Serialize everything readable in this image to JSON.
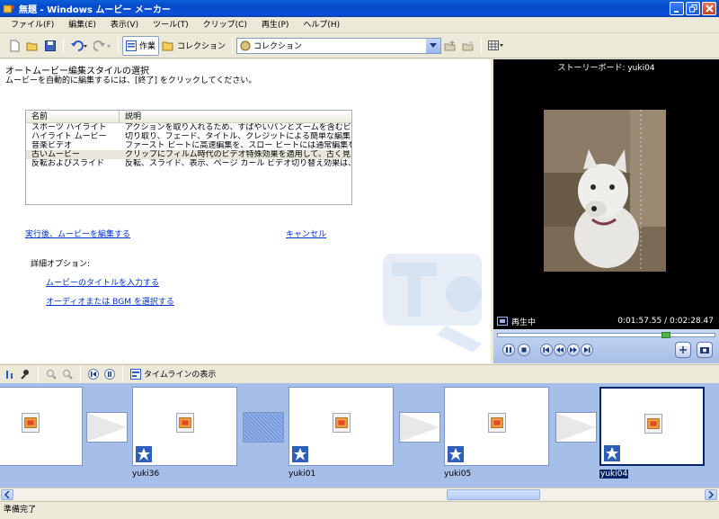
{
  "window": {
    "title": "無題 - Windows ムービー メーカー"
  },
  "menu": {
    "items": [
      "ファイル(F)",
      "編集(E)",
      "表示(V)",
      "ツール(T)",
      "クリップ(C)",
      "再生(P)",
      "ヘルプ(H)"
    ]
  },
  "toolbar": {
    "tasks_label": "作業",
    "collections_label": "コレクション",
    "collection_combo_value": "コレクション"
  },
  "task_pane": {
    "title": "オートムービー編集スタイルの選択",
    "subtitle": "ムービーを自動的に編集するには、[終了] をクリックしてください。",
    "columns": [
      "名前",
      "説明"
    ],
    "styles": [
      {
        "name": "スポーツ ハイライト",
        "desc": "アクションを取り入れるため、すばやいパンとズームを含むビデオクリッ..."
      },
      {
        "name": "ハイライト ムービー",
        "desc": "切り取り、フェード、タイトル、クレジットによる簡単な編集"
      },
      {
        "name": "音楽ビデオ",
        "desc": "ファースト ビートに高速編集を、スロー ビートには通常編集を使用..."
      },
      {
        "name": "古いムービー",
        "desc": "クリップにフィルム時代のビデオ特殊効果を適用して、古く見えるムー..."
      },
      {
        "name": "反転およびスライド",
        "desc": "反転、スライド、表示、ページ カール ビデオ切り替え効果は、クリッ..."
      }
    ],
    "run_link": "実行後、ムービーを編集する",
    "cancel_link": "キャンセル",
    "options_label": "詳細オプション:",
    "title_link": "ムービーのタイトルを入力する",
    "audio_link": "オーディオまたは BGM を選択する"
  },
  "preview": {
    "title": "ストーリーボード: yuki04",
    "state": "再生中",
    "time": "0:01:57.55 / 0:02:28.47",
    "seek_fraction": 0.79
  },
  "storyboard_toolbar": {
    "timeline_label": "タイムラインの表示"
  },
  "storyboard": {
    "clips": [
      {
        "name": ""
      },
      {
        "name": "yuki36"
      },
      {
        "name": "yuki01"
      },
      {
        "name": "yuki05"
      },
      {
        "name": "yuki04"
      }
    ]
  },
  "status": {
    "text": "準備完了"
  },
  "colors": {
    "accent": "#0a246a",
    "storyboard_bg": "#a5bfe8",
    "link": "#0033cc"
  }
}
